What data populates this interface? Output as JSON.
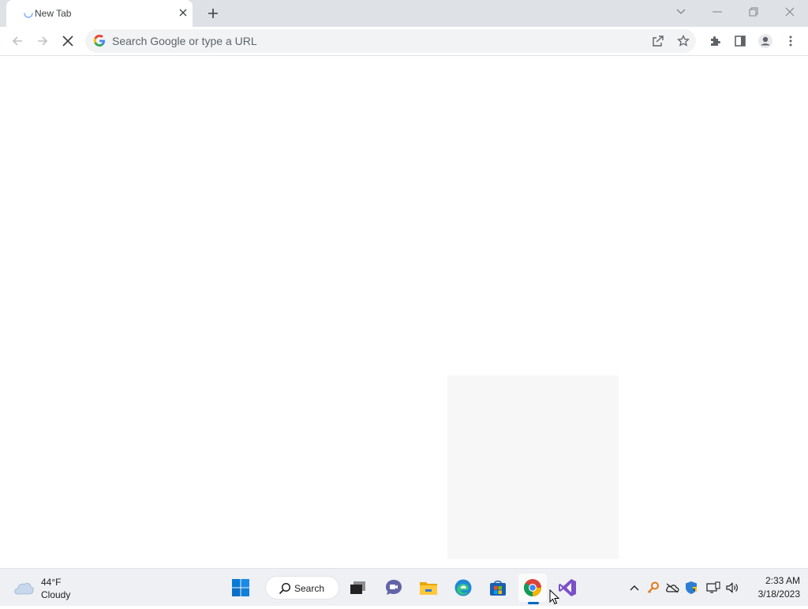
{
  "browser": {
    "tab": {
      "title": "New Tab"
    },
    "omnibox": {
      "placeholder": "Search Google or type a URL"
    }
  },
  "taskbar": {
    "weather": {
      "temp": "44°F",
      "condition": "Cloudy"
    },
    "search_label": "Search",
    "clock": {
      "time": "2:33 AM",
      "date": "3/18/2023"
    },
    "pinned_apps": [
      "start-icon",
      "search-icon",
      "task-view-icon",
      "chat-icon",
      "file-explorer-icon",
      "edge-icon",
      "store-icon",
      "chrome-icon",
      "visual-studio-icon"
    ],
    "tray_icons": [
      "chevron-up-icon",
      "key-icon",
      "onedrive-icon",
      "defender-icon",
      "network-icon",
      "volume-icon"
    ]
  },
  "colors": {
    "tab_strip": "#dee1e6",
    "taskbar": "#eef0f4",
    "accent": "#0067c0"
  }
}
